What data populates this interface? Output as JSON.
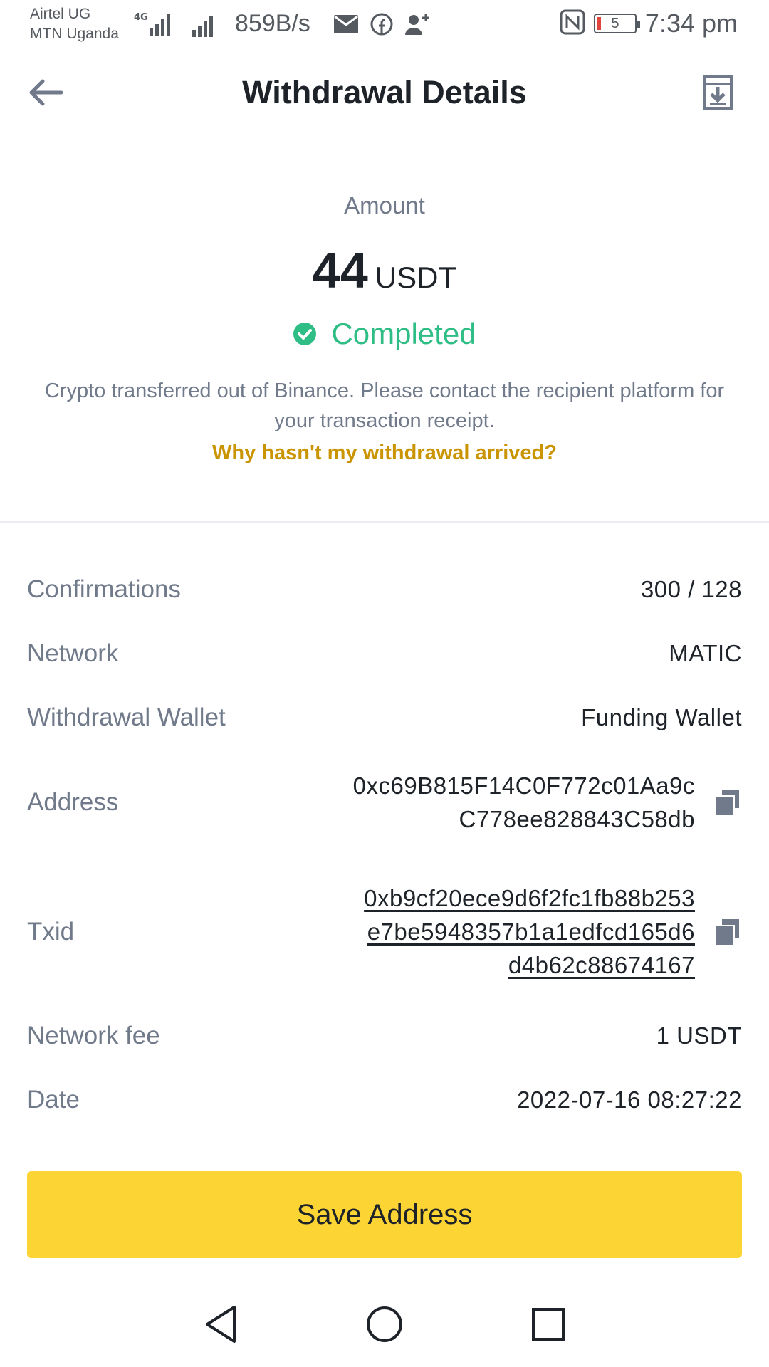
{
  "status_bar": {
    "carrier1": "Airtel UG",
    "carrier2": "MTN Uganda",
    "network_type": "4G",
    "speed": "859B/s",
    "battery": "5",
    "time": "7:34 pm"
  },
  "header": {
    "title": "Withdrawal Details"
  },
  "summary": {
    "amount_label": "Amount",
    "amount_value": "44",
    "amount_unit": "USDT",
    "status": "Completed",
    "description": "Crypto transferred out of Binance. Please contact the recipient platform for your transaction receipt.",
    "help_link": "Why hasn't my withdrawal arrived?"
  },
  "details": {
    "confirmations": {
      "label": "Confirmations",
      "value": "300 / 128"
    },
    "network": {
      "label": "Network",
      "value": "MATIC"
    },
    "wallet": {
      "label": "Withdrawal Wallet",
      "value": "Funding Wallet"
    },
    "address": {
      "label": "Address",
      "line1": "0xc69B815F14C0F772c01Aa9c",
      "line2": "C778ee828843C58db"
    },
    "txid": {
      "label": "Txid",
      "line1": "0xb9cf20ece9d6f2fc1fb88b253",
      "line2": "e7be5948357b1a1edfcd165d6",
      "line3": "d4b62c88674167"
    },
    "fee": {
      "label": "Network fee",
      "value": "1 USDT"
    },
    "date": {
      "label": "Date",
      "value": "2022-07-16 08:27:22"
    }
  },
  "actions": {
    "save_address": "Save Address"
  },
  "colors": {
    "accent": "#fcd535",
    "success": "#2ebd85",
    "link": "#c99400",
    "text_primary": "#1e2329",
    "text_secondary": "#707a8a"
  }
}
